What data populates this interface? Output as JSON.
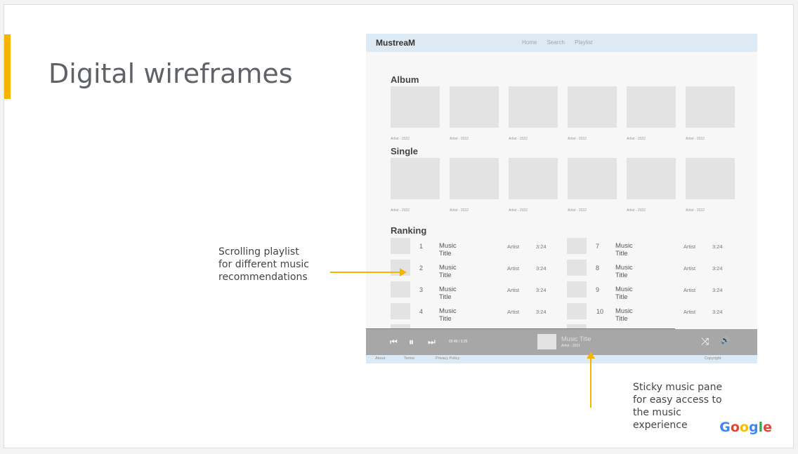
{
  "slide": {
    "title": "Digital wireframes"
  },
  "callouts": {
    "playlist": [
      "Scrolling playlist",
      "for different music",
      "recommendations"
    ],
    "player": [
      "Sticky music pane",
      "for easy access to",
      "the music",
      "experience"
    ]
  },
  "logo": [
    "G",
    "o",
    "o",
    "g",
    "l",
    "e"
  ],
  "app": {
    "brand": "MustreaM",
    "nav": [
      "Home",
      "Search",
      "Playlist"
    ],
    "album": {
      "title": "Album",
      "captions": [
        "Artist - 2022",
        "Artist - 2022",
        "Artist - 2022",
        "Artist - 2022",
        "Artist - 2022",
        "Artist - 2022"
      ]
    },
    "single": {
      "title": "Single",
      "captions": [
        "Artist - 2022",
        "Artist - 2022",
        "Artist - 2022",
        "Artist - 2022",
        "Artist - 2022",
        "Artist - 2022"
      ]
    },
    "ranking": {
      "title": "Ranking",
      "left": [
        {
          "num": "1",
          "title": "Music Title",
          "artist": "Artist",
          "time": "3:24"
        },
        {
          "num": "2",
          "title": "Music Title",
          "artist": "Artist",
          "time": "3:24"
        },
        {
          "num": "3",
          "title": "Music Title",
          "artist": "Artist",
          "time": "3:24"
        },
        {
          "num": "4",
          "title": "Music Title",
          "artist": "Artist",
          "time": "3:24"
        }
      ],
      "right": [
        {
          "num": "7",
          "title": "Music Title",
          "artist": "Artist",
          "time": "3:24"
        },
        {
          "num": "8",
          "title": "Music Title",
          "artist": "Artist",
          "time": "3:24"
        },
        {
          "num": "9",
          "title": "Music Title",
          "artist": "Artist",
          "time": "3:24"
        },
        {
          "num": "10",
          "title": "Music Title",
          "artist": "Artist",
          "time": "3:24"
        }
      ]
    },
    "player": {
      "time": "02:45 / 3:25",
      "title": "Music Title",
      "artist": "Artist - 2021",
      "icons": {
        "prev": "⏮",
        "pause": "⏸",
        "next": "⏭",
        "shuffle": "⤨",
        "volume": "🔊"
      }
    },
    "footer": {
      "about": "About",
      "terms": "Terms",
      "privacy": "Privacy Policy",
      "copyright": "Copyright"
    }
  }
}
